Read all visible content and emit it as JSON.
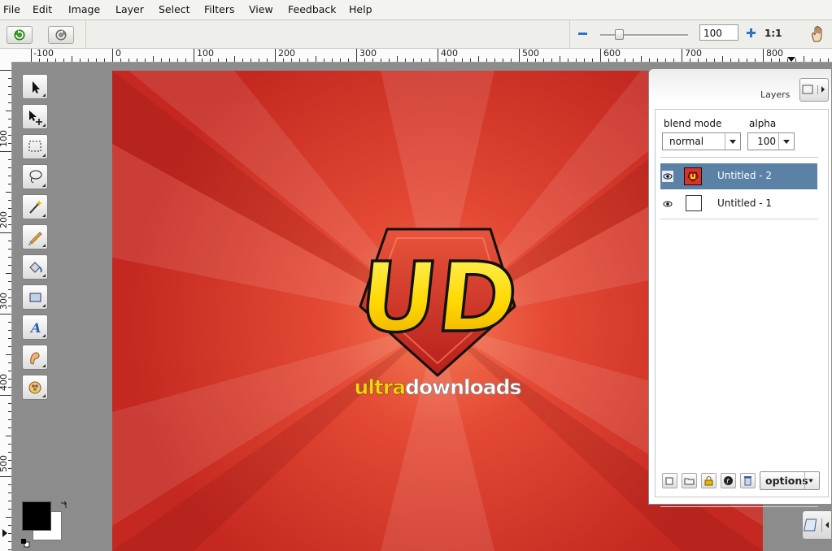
{
  "menu": {
    "items": [
      "File",
      "Edit",
      "Image",
      "Layer",
      "Select",
      "Filters",
      "View",
      "Feedback",
      "Help"
    ]
  },
  "toolbar": {
    "undo_icon": "undo-icon",
    "redo_icon": "redo-icon",
    "zoom_value": "100",
    "zoom_slider_fraction": 0.21,
    "actual_size_label": "1:1",
    "hand_icon": "hand-icon"
  },
  "rulers": {
    "horizontal": [
      "-100",
      "0",
      "100",
      "200",
      "300",
      "400",
      "500",
      "600",
      "700",
      "800"
    ],
    "vertical": [
      "100",
      "200",
      "300",
      "400",
      "500"
    ]
  },
  "tools": [
    "pointer-tool-icon",
    "move-tool-icon",
    "marquee-tool-icon",
    "lasso-tool-icon",
    "magic-wand-icon",
    "brush-icon",
    "paint-bucket-icon",
    "shape-tool-icon",
    "text-tool-icon",
    "smudge-tool-icon",
    "color-picker-icon"
  ],
  "canvas": {
    "logo_letters": "UD",
    "logo_text_highlight": "ultra",
    "logo_text_rest": "downloads"
  },
  "layers_panel": {
    "title": "Layers",
    "blend_mode_label": "blend mode",
    "blend_mode_value": "normal",
    "alpha_label": "alpha",
    "alpha_value": "100",
    "layers": [
      {
        "name": "Untitled - 2",
        "selected": true
      },
      {
        "name": "Untitled - 1",
        "selected": false
      }
    ],
    "options_label": "options"
  },
  "colors": {
    "foreground": "#000000",
    "background": "#ffffff",
    "selected_layer": "#5b82a6",
    "canvas_red": "#d9322a"
  }
}
